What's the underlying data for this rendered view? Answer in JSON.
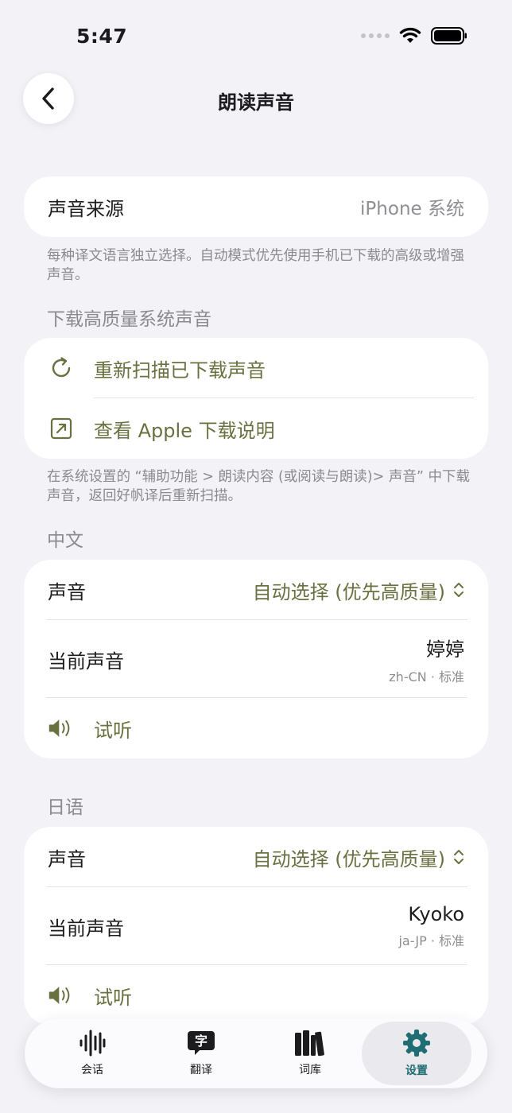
{
  "status_bar": {
    "time": "5:47"
  },
  "nav": {
    "title": "朗读声音"
  },
  "source": {
    "label": "声音来源",
    "value": "iPhone 系统"
  },
  "source_note": "每种译文语言独立选择。自动模式优先使用手机已下载的高级或增强声音。",
  "download": {
    "header": "下载高质量系统声音",
    "rescan_label": "重新扫描已下载声音",
    "guide_label": "查看 Apple 下载说明",
    "note": "在系统设置的 “辅助功能 > 朗读内容 (或阅读与朗读)> 声音” 中下载声音，返回好帆译后重新扫描。"
  },
  "languages": [
    {
      "header": "中文",
      "voice_label": "声音",
      "voice_value": "自动选择 (优先高质量)",
      "current_label": "当前声音",
      "current_name": "婷婷",
      "current_meta": "zh-CN · 标准",
      "preview_label": "试听"
    },
    {
      "header": "日语",
      "voice_label": "声音",
      "voice_value": "自动选择 (优先高质量)",
      "current_label": "当前声音",
      "current_name": "Kyoko",
      "current_meta": "ja-JP · 标准",
      "preview_label": "试听"
    }
  ],
  "tabs": [
    {
      "label": "会话",
      "icon": "waveform-icon"
    },
    {
      "label": "翻译",
      "icon": "translate-icon"
    },
    {
      "label": "词库",
      "icon": "library-icon"
    },
    {
      "label": "设置",
      "icon": "gear-icon",
      "active": true
    }
  ],
  "colors": {
    "accent": "#6b7040",
    "active_tab": "#1f6e73",
    "background": "#f2f2f7"
  }
}
